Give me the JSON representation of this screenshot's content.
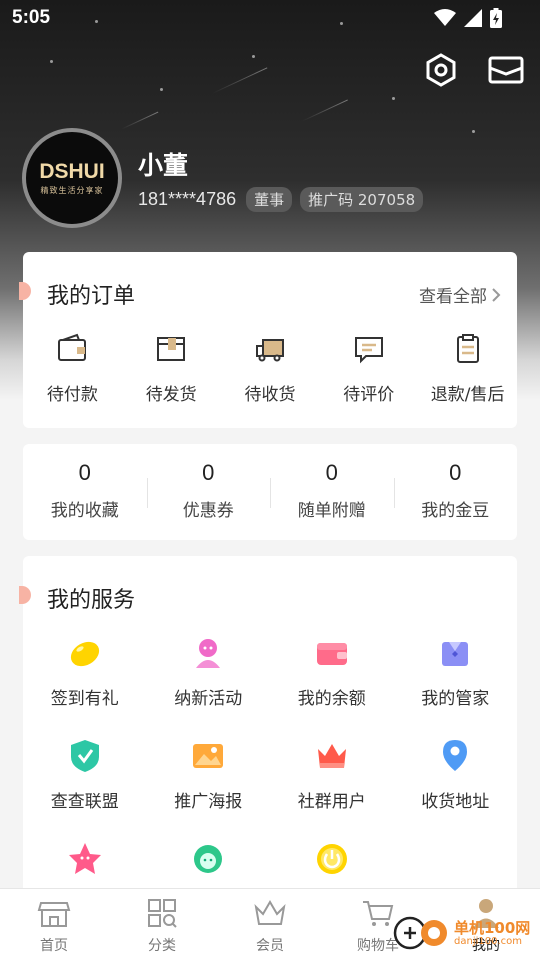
{
  "status_bar": {
    "time": "5:05",
    "icons": [
      "wifi-icon",
      "signal-icon",
      "battery-charging-icon"
    ]
  },
  "header": {
    "settings_icon": "gear-icon",
    "message_icon": "envelope-icon"
  },
  "profile": {
    "avatar_logo": "DSHUI",
    "avatar_tagline": "精致生活分享家",
    "name": "小董",
    "phone": "181****4786",
    "role_badge": "董事",
    "promo_code": "推广码 207058"
  },
  "orders": {
    "title": "我的订单",
    "view_all": "查看全部",
    "items": [
      {
        "label": "待付款",
        "icon": "wallet-icon"
      },
      {
        "label": "待发货",
        "icon": "package-icon"
      },
      {
        "label": "待收货",
        "icon": "truck-icon"
      },
      {
        "label": "待评价",
        "icon": "comment-icon"
      },
      {
        "label": "退款/售后",
        "icon": "clipboard-icon"
      }
    ]
  },
  "stats": [
    {
      "value": "0",
      "label": "我的收藏"
    },
    {
      "value": "0",
      "label": "优惠券"
    },
    {
      "value": "0",
      "label": "随单附赠"
    },
    {
      "value": "0",
      "label": "我的金豆"
    }
  ],
  "services": {
    "title": "我的服务",
    "items": [
      {
        "label": "签到有礼",
        "icon": "bean-icon",
        "color": "#ffd400"
      },
      {
        "label": "纳新活动",
        "icon": "person-icon",
        "color": "#f06ac8"
      },
      {
        "label": "我的余额",
        "icon": "wallet-icon",
        "color": "#ff6b8a"
      },
      {
        "label": "我的管家",
        "icon": "butler-icon",
        "color": "#8b8ff5"
      },
      {
        "label": "查查联盟",
        "icon": "shield-check-icon",
        "color": "#2dc7a5"
      },
      {
        "label": "推广海报",
        "icon": "picture-icon",
        "color": "#ffa93a"
      },
      {
        "label": "社群用户",
        "icon": "crown-icon",
        "color": "#ff5a4a"
      },
      {
        "label": "收货地址",
        "icon": "location-pin-icon",
        "color": "#4f9bf5"
      },
      {
        "label": "",
        "icon": "star-face-icon",
        "color": "#ff5a8a"
      },
      {
        "label": "",
        "icon": "avatar-icon",
        "color": "#2dc78a"
      },
      {
        "label": "",
        "icon": "power-icon",
        "color": "#ffd400"
      }
    ]
  },
  "tabbar": {
    "items": [
      {
        "label": "首页",
        "icon": "store-icon",
        "active": false
      },
      {
        "label": "分类",
        "icon": "category-icon",
        "active": false
      },
      {
        "label": "会员",
        "icon": "crown-icon",
        "active": false
      },
      {
        "label": "购物车",
        "icon": "cart-icon",
        "active": false
      },
      {
        "label": "我的",
        "icon": "user-icon",
        "active": true
      }
    ]
  },
  "watermark": {
    "text": "单机100网",
    "url": "danji100.com"
  }
}
